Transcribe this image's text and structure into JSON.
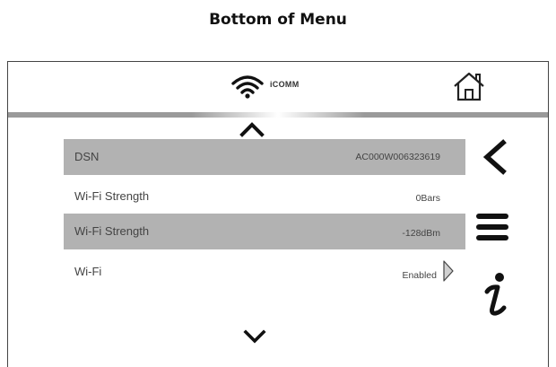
{
  "caption": "Bottom of Menu",
  "header": {
    "brand": "iCOMM"
  },
  "rows": [
    {
      "label": "DSN",
      "value": "AC000W006323619"
    },
    {
      "label": "Wi-Fi Strength",
      "value": "0Bars"
    },
    {
      "label": "Wi-Fi Strength",
      "value": "-128dBm"
    },
    {
      "label": "Wi-Fi",
      "value": "Enabled"
    }
  ],
  "icons": [
    "wifi-icon",
    "home-icon",
    "scroll-up-icon",
    "scroll-down-icon",
    "back-icon",
    "menu-icon",
    "info-icon",
    "chevron-right-icon"
  ],
  "colors": {
    "row_highlight": "#b2b2b2",
    "text": "#444444",
    "frame": "#444444"
  }
}
